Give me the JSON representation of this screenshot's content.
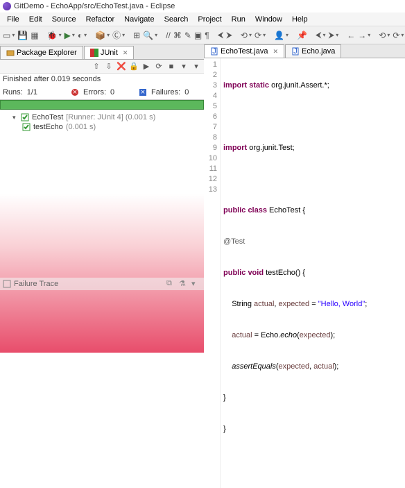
{
  "window": {
    "title": "GitDemo - EchoApp/src/EchoTest.java - Eclipse"
  },
  "menu": [
    "File",
    "Edit",
    "Source",
    "Refactor",
    "Navigate",
    "Search",
    "Project",
    "Run",
    "Window",
    "Help"
  ],
  "left_tabs": {
    "pkg": "Package Explorer",
    "junit": "JUnit"
  },
  "junit": {
    "status": "Finished after 0.019 seconds",
    "runs_label": "Runs:",
    "runs_value": "1/1",
    "errors_label": "Errors:",
    "errors_value": "0",
    "failures_label": "Failures:",
    "failures_value": "0",
    "tree": {
      "root_name": "EchoTest",
      "root_meta": "[Runner: JUnit 4] (0.001 s)",
      "child_name": "testEcho",
      "child_meta": "(0.001 s)"
    },
    "trace_title": "Failure Trace"
  },
  "editor_tabs": {
    "active": "EchoTest.java",
    "other": "Echo.java"
  },
  "code": {
    "lines": [
      "1",
      "2",
      "3",
      "4",
      "5",
      "6",
      "7",
      "8",
      "9",
      "10",
      "11",
      "12",
      "13"
    ],
    "l1a": "import static",
    "l1b": " org.junit.Assert.*;",
    "l3a": "import",
    "l3b": " org.junit.Test;",
    "l5a": "public class",
    "l5b": " EchoTest {",
    "l6": "@Test",
    "l7a": "public void",
    "l7b": " testEcho() {",
    "l8a": "    String ",
    "l8b": "actual",
    "l8c": ", ",
    "l8d": "expected",
    "l8e": " = ",
    "l8f": "\"Hello, World\"",
    "l8g": ";",
    "l9a": "    ",
    "l9b": "actual",
    "l9c": " = Echo.",
    "l9d": "echo",
    "l9e": "(",
    "l9f": "expected",
    "l9g": ");",
    "l10a": "    ",
    "l10b": "assertEquals",
    "l10c": "(",
    "l10d": "expected",
    "l10e": ", ",
    "l10f": "actual",
    "l10g": ");",
    "l11": "}",
    "l12": "}"
  }
}
